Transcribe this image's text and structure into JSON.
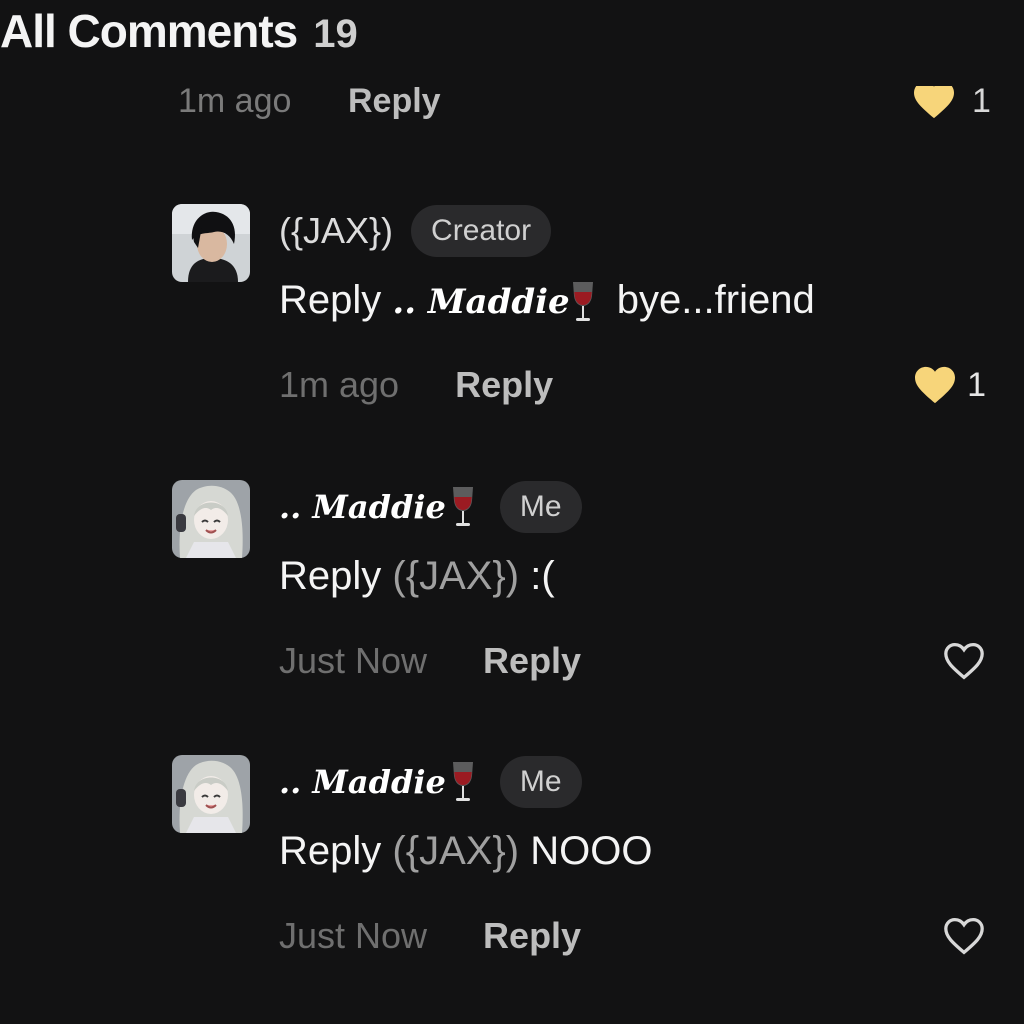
{
  "header": {
    "title": "All Comments",
    "count": "19"
  },
  "partial_comment": {
    "timestamp": "1m ago",
    "reply_label": "Reply",
    "likes": "1",
    "liked": true
  },
  "comments": [
    {
      "username": "({JAX})",
      "username_style": "plain",
      "badge": "Creator",
      "reply_prefix": "Reply",
      "mention": ".. Maddie",
      "mention_has_wine_icon": true,
      "text": "bye...friend",
      "timestamp": "1m ago",
      "reply_label": "Reply",
      "likes": "1",
      "liked": true,
      "avatar": "dark-haired-boy-avatar"
    },
    {
      "username": ".. Maddie",
      "username_style": "script",
      "username_has_wine_icon": true,
      "badge": "Me",
      "reply_prefix": "Reply",
      "mention": "({JAX})",
      "text": ":(",
      "timestamp": "Just Now",
      "reply_label": "Reply",
      "likes": "",
      "liked": false,
      "avatar": "anime-girl-avatar"
    },
    {
      "username": ".. Maddie",
      "username_style": "script",
      "username_has_wine_icon": true,
      "badge": "Me",
      "reply_prefix": "Reply",
      "mention": "({JAX})",
      "text": "NOOO",
      "timestamp": "Just Now",
      "reply_label": "Reply",
      "likes": "",
      "liked": false,
      "avatar": "anime-girl-avatar"
    }
  ],
  "colors": {
    "background": "#121213",
    "liked_heart": "#f7d57a",
    "unliked_heart": "#d8d8d8",
    "wine": "#9b1b22"
  },
  "icons": {
    "heart_filled": "heart-filled-icon",
    "heart_outline": "heart-outline-icon",
    "wine_glass": "wine-glass-icon"
  }
}
